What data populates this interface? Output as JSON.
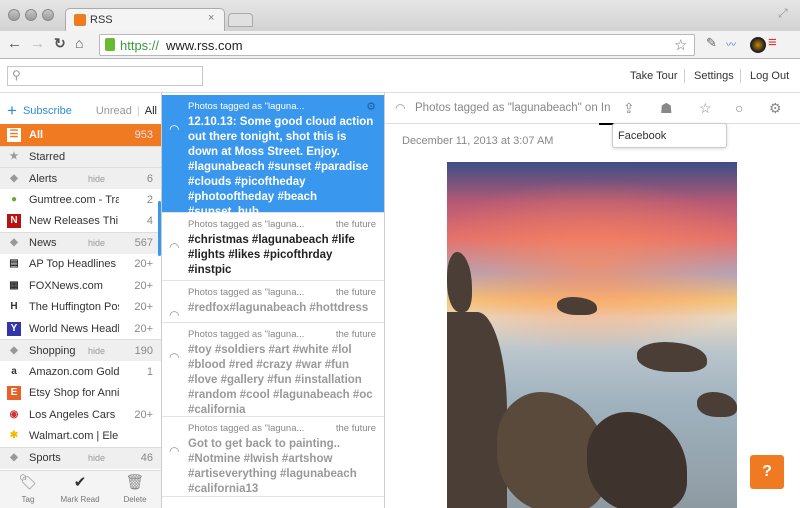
{
  "browser": {
    "tab_title": "RSS",
    "url_scheme": "https://",
    "url_host": "www.rss.com"
  },
  "header": {
    "search_placeholder": "",
    "links": [
      "Take Tour",
      "Settings",
      "Log Out"
    ]
  },
  "sidebar": {
    "subscribe": "Subscribe",
    "filter_unread": "Unread",
    "filter_all": "All",
    "hide_label": "hide",
    "items": [
      {
        "label": "All",
        "count": "953",
        "type": "all"
      },
      {
        "label": "Starred",
        "count": "",
        "type": "starred"
      },
      {
        "label": "Alerts",
        "count": "6",
        "type": "category"
      },
      {
        "label": "Gumtree.com - Tra...",
        "count": "2",
        "type": "feed",
        "icon": "gumtree-icon"
      },
      {
        "label": "New Releases Thi...",
        "count": "4",
        "type": "feed",
        "icon": "netflix-icon"
      },
      {
        "label": "News",
        "count": "567",
        "type": "category"
      },
      {
        "label": "AP Top Headlines ...",
        "count": "20+",
        "type": "feed",
        "icon": "ap-icon"
      },
      {
        "label": "FOXNews.com",
        "count": "20+",
        "type": "feed",
        "icon": "foxnews-icon"
      },
      {
        "label": "The Huffington Pos...",
        "count": "20+",
        "type": "feed",
        "icon": "huffpost-icon"
      },
      {
        "label": "World News Headl...",
        "count": "20+",
        "type": "feed",
        "icon": "yahoo-icon"
      },
      {
        "label": "Shopping",
        "count": "190",
        "type": "category"
      },
      {
        "label": "Amazon.com Gold...",
        "count": "1",
        "type": "feed",
        "icon": "amazon-icon"
      },
      {
        "label": "Etsy Shop for Anni...",
        "count": "",
        "type": "feed",
        "icon": "etsy-icon"
      },
      {
        "label": "Los Angeles Cars ...",
        "count": "20+",
        "type": "feed",
        "icon": "craigslist-icon"
      },
      {
        "label": "Walmart.com | Ele...",
        "count": "",
        "type": "feed",
        "icon": "walmart-icon"
      },
      {
        "label": "Sports",
        "count": "46",
        "type": "category"
      }
    ],
    "footer": [
      "Tag",
      "Mark Read",
      "Delete"
    ]
  },
  "list": {
    "items": [
      {
        "source": "Photos tagged as \"laguna...",
        "time": "",
        "title": "12.10.13: Some good cloud action out there tonight, shot this is down at Moss Street. Enjoy. #lagunabeach #sunset #paradise #clouds #picoftheday #photooftheday #beach #sunset_hub",
        "state": "selected"
      },
      {
        "source": "Photos tagged as \"laguna...",
        "time": "the future",
        "title": "#christmas #lagunabeach #life #lights #likes #picofthrday #instpic",
        "state": "unread"
      },
      {
        "source": "Photos tagged as \"laguna...",
        "time": "the future",
        "title": "#redfox#lagunabeach #hottdress",
        "state": "read"
      },
      {
        "source": "Photos tagged as \"laguna...",
        "time": "the future",
        "title": "#toy #soldiers #art #white #lol #blood #red #crazy #war #fun #love #gallery #fun #installation #random #cool #lagunabeach #oc #california",
        "state": "read"
      },
      {
        "source": "Photos tagged as \"laguna...",
        "time": "the future",
        "title": "Got to get back to painting.. #Notmine #Iwish #artshow #artiseverything #lagunabeach #california13",
        "state": "read"
      }
    ]
  },
  "detail": {
    "feed_title": "Photos tagged as \"lagunabeach\" on In",
    "date": "December 11, 2013 at 3:07 AM",
    "tooltip": "Facebook",
    "help": "?"
  },
  "colors": {
    "accent": "#f07a22",
    "selected": "#3a97ee",
    "link": "#2b8fd6"
  }
}
